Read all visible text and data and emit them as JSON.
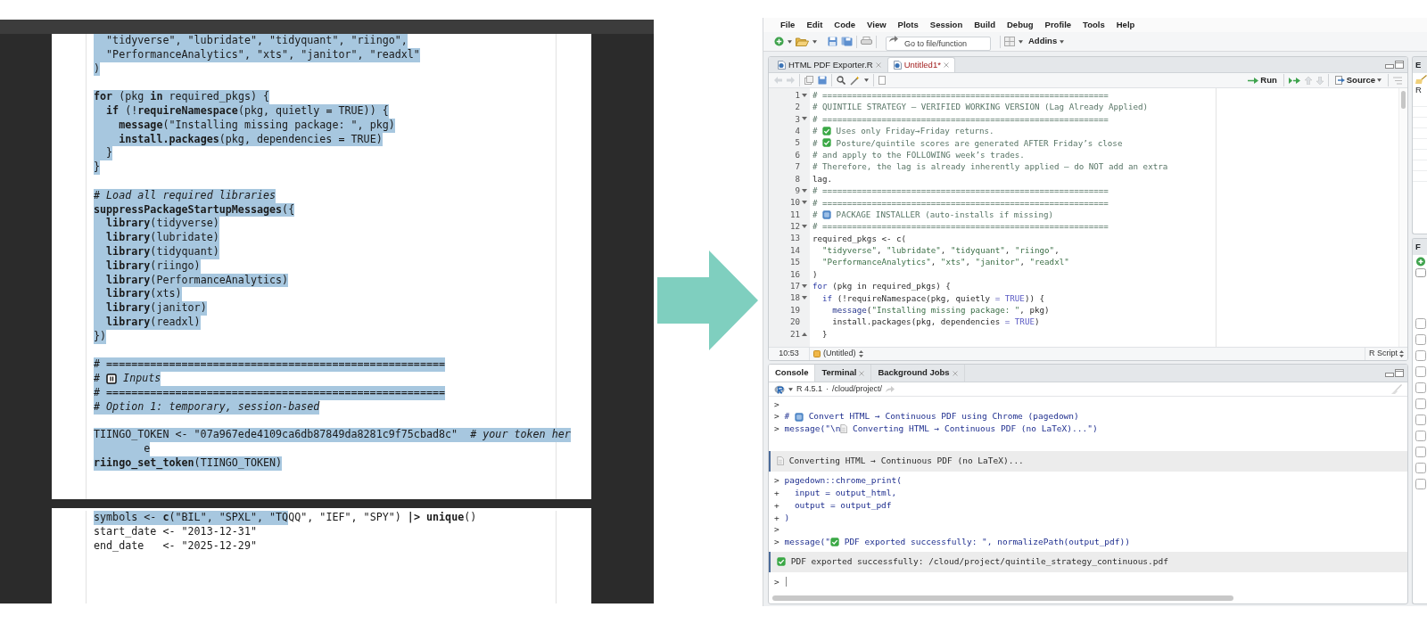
{
  "pdf": {
    "pages": [
      {
        "lines": [
          {
            "gap": false,
            "parts": [
              {
                "kind": "code",
                "text": "  \"tidyverse\", \"lubridate\", \"tidyquant\", \"riingo\",",
                "selected": true
              }
            ]
          },
          {
            "gap": false,
            "parts": [
              {
                "kind": "code",
                "text": "  \"PerformanceAnalytics\", \"xts\", \"janitor\", \"readxl\"",
                "selected": true
              }
            ]
          },
          {
            "gap": false,
            "parts": [
              {
                "kind": "code",
                "text": ")",
                "selected": true
              }
            ]
          },
          {
            "gap": true,
            "parts": [
              {
                "kind": "code",
                "text": "**for** (pkg **in** required_pkgs) {",
                "selected": true
              }
            ]
          },
          {
            "gap": false,
            "parts": [
              {
                "kind": "code",
                "text": "  **if** (!**requireNamespace**(pkg, quietly = TRUE)) {",
                "selected": true
              }
            ]
          },
          {
            "gap": false,
            "parts": [
              {
                "kind": "code",
                "text": "    **message**(\"Installing missing package: \", pkg)",
                "selected": true
              }
            ]
          },
          {
            "gap": false,
            "parts": [
              {
                "kind": "code",
                "text": "    **install.packages**(pkg, dependencies = TRUE)",
                "selected": true
              }
            ]
          },
          {
            "gap": false,
            "parts": [
              {
                "kind": "code",
                "text": "  }",
                "selected": true
              }
            ]
          },
          {
            "gap": false,
            "parts": [
              {
                "kind": "code",
                "text": "}",
                "selected": true
              }
            ]
          },
          {
            "gap": true,
            "parts": [
              {
                "kind": "comment",
                "text": "# Load all required libraries",
                "selected": true
              }
            ]
          },
          {
            "gap": false,
            "parts": [
              {
                "kind": "code",
                "text": "**suppressPackageStartupMessages**({",
                "selected": true
              }
            ]
          },
          {
            "gap": false,
            "parts": [
              {
                "kind": "code",
                "text": "  **library**(tidyverse)",
                "selected": true
              }
            ]
          },
          {
            "gap": false,
            "parts": [
              {
                "kind": "code",
                "text": "  **library**(lubridate)",
                "selected": true
              }
            ]
          },
          {
            "gap": false,
            "parts": [
              {
                "kind": "code",
                "text": "  **library**(tidyquant)",
                "selected": true
              }
            ]
          },
          {
            "gap": false,
            "parts": [
              {
                "kind": "code",
                "text": "  **library**(riingo)",
                "selected": true
              }
            ]
          },
          {
            "gap": false,
            "parts": [
              {
                "kind": "code",
                "text": "  **library**(PerformanceAnalytics)",
                "selected": true
              }
            ]
          },
          {
            "gap": false,
            "parts": [
              {
                "kind": "code",
                "text": "  **library**(xts)",
                "selected": true
              }
            ]
          },
          {
            "gap": false,
            "parts": [
              {
                "kind": "code",
                "text": "  **library**(janitor)",
                "selected": true
              }
            ]
          },
          {
            "gap": false,
            "parts": [
              {
                "kind": "code",
                "text": "  **library**(readxl)",
                "selected": true
              }
            ]
          },
          {
            "gap": false,
            "parts": [
              {
                "kind": "code",
                "text": "})",
                "selected": true
              }
            ]
          },
          {
            "gap": true,
            "parts": [
              {
                "kind": "comment",
                "text": "# ======================================================",
                "selected": true
              }
            ]
          },
          {
            "gap": false,
            "parts": [
              {
                "kind": "comment",
                "text": "# ",
                "selected": true
              },
              {
                "kind": "keycap",
                "selected": true
              },
              {
                "kind": "comment",
                "text": " Inputs",
                "selected": true
              }
            ]
          },
          {
            "gap": false,
            "parts": [
              {
                "kind": "comment",
                "text": "# ======================================================",
                "selected": true
              }
            ]
          },
          {
            "gap": false,
            "parts": [
              {
                "kind": "comment",
                "text": "# Option 1: temporary, session-based",
                "selected": true
              }
            ]
          },
          {
            "gap": true,
            "parts": [
              {
                "kind": "code",
                "text": "TIINGO_TOKEN <- \"07a967ede4109ca6db87849da8281c9f75cbad8c\"  ",
                "selected": true
              },
              {
                "kind": "comment",
                "text": "# your token her",
                "selected": true
              }
            ]
          },
          {
            "gap": false,
            "parts": [
              {
                "kind": "code",
                "text": "        e",
                "selected": true
              }
            ]
          },
          {
            "gap": false,
            "parts": [
              {
                "kind": "code",
                "text": "**riingo_set_token**(TIINGO_TOKEN)",
                "selected": true
              }
            ]
          }
        ]
      },
      {
        "lines": [
          {
            "parts": [
              {
                "kind": "code",
                "text": "symbols <- **c**(\"BIL\", \"SPXL\", \"TQ",
                "selected": true
              },
              {
                "kind": "code",
                "text": "QQ\", \"IEF\", \"SPY\") **|>** **unique**()",
                "selected": false
              }
            ]
          },
          {
            "parts": [
              {
                "kind": "code",
                "text": "start_date <- \"2013-12-31\"",
                "selected": false
              }
            ]
          },
          {
            "parts": [
              {
                "kind": "code",
                "text": "end_date   <- \"2025-12-29\"",
                "selected": false
              }
            ]
          }
        ]
      }
    ]
  },
  "rstudio": {
    "menu": [
      "File",
      "Edit",
      "Code",
      "View",
      "Plots",
      "Session",
      "Build",
      "Debug",
      "Profile",
      "Tools",
      "Help"
    ],
    "toolbar": {
      "goto_placeholder": "Go to file/function",
      "addins": "Addins"
    },
    "editor": {
      "tabs": [
        {
          "label": "HTML PDF Exporter.R",
          "selected": false,
          "modified": false
        },
        {
          "label": "Untitled1*",
          "selected": true,
          "modified": true
        }
      ],
      "run": "Run",
      "source": "Source",
      "lines": [
        {
          "num": "1",
          "kind": "fold_start",
          "segs": [
            {
              "kind": "comment",
              "text": "# =========================================================="
            }
          ]
        },
        {
          "num": "2",
          "kind": "plain",
          "segs": [
            {
              "kind": "comment",
              "text": "# QUINTILE STRATEGY – VERIFIED WORKING VERSION (Lag Already Applied)"
            }
          ]
        },
        {
          "num": "3",
          "kind": "fold_start",
          "segs": [
            {
              "kind": "comment",
              "text": "# =========================================================="
            }
          ]
        },
        {
          "num": "4",
          "kind": "plain",
          "segs": [
            {
              "kind": "comment",
              "text": "# "
            },
            {
              "kind": "check"
            },
            {
              "kind": "comment",
              "text": " Uses only Friday→Friday returns."
            }
          ]
        },
        {
          "num": "5",
          "kind": "plain",
          "segs": [
            {
              "kind": "comment",
              "text": "# "
            },
            {
              "kind": "check"
            },
            {
              "kind": "comment",
              "text": " Posture/quintile scores are generated AFTER Friday’s close"
            }
          ]
        },
        {
          "num": "6",
          "kind": "plain",
          "segs": [
            {
              "kind": "comment",
              "text": "# and apply to the FOLLOWING week’s trades."
            }
          ]
        },
        {
          "num": "7",
          "kind": "plain",
          "segs": [
            {
              "kind": "comment",
              "text": "# Therefore, the lag is already inherently applied – do NOT add an extra"
            }
          ]
        },
        {
          "num": "8",
          "kind": "plain",
          "segs": [
            {
              "kind": "plain",
              "text": "lag."
            }
          ]
        },
        {
          "num": "9",
          "kind": "fold_start",
          "segs": [
            {
              "kind": "comment",
              "text": "# =========================================================="
            }
          ]
        },
        {
          "num": "10",
          "kind": "fold_start",
          "segs": [
            {
              "kind": "comment",
              "text": "# =========================================================="
            }
          ]
        },
        {
          "num": "11",
          "kind": "plain",
          "segs": [
            {
              "kind": "comment",
              "text": "# "
            },
            {
              "kind": "keycap"
            },
            {
              "kind": "comment",
              "text": " PACKAGE INSTALLER (auto-installs if missing)"
            }
          ]
        },
        {
          "num": "12",
          "kind": "fold_start",
          "segs": [
            {
              "kind": "comment",
              "text": "# =========================================================="
            }
          ]
        },
        {
          "num": "13",
          "kind": "plain",
          "segs": [
            {
              "kind": "plain",
              "text": "required_pkgs <- c("
            }
          ]
        },
        {
          "num": "14",
          "kind": "plain",
          "segs": [
            {
              "kind": "string",
              "text": "  \"tidyverse\""
            },
            {
              "kind": "plain",
              "text": ", "
            },
            {
              "kind": "string",
              "text": "\"lubridate\""
            },
            {
              "kind": "plain",
              "text": ", "
            },
            {
              "kind": "string",
              "text": "\"tidyquant\""
            },
            {
              "kind": "plain",
              "text": ", "
            },
            {
              "kind": "string",
              "text": "\"riingo\""
            },
            {
              "kind": "plain",
              "text": ","
            }
          ]
        },
        {
          "num": "15",
          "kind": "plain",
          "segs": [
            {
              "kind": "string",
              "text": "  \"PerformanceAnalytics\""
            },
            {
              "kind": "plain",
              "text": ", "
            },
            {
              "kind": "string",
              "text": "\"xts\""
            },
            {
              "kind": "plain",
              "text": ", "
            },
            {
              "kind": "string",
              "text": "\"janitor\""
            },
            {
              "kind": "plain",
              "text": ", "
            },
            {
              "kind": "string",
              "text": "\"readxl\""
            }
          ]
        },
        {
          "num": "16",
          "kind": "plain",
          "segs": [
            {
              "kind": "plain",
              "text": ")"
            }
          ]
        },
        {
          "num": "17",
          "kind": "fold_start",
          "segs": [
            {
              "kind": "keyword",
              "text": "for"
            },
            {
              "kind": "plain",
              "text": " (pkg in required_pkgs) {"
            }
          ]
        },
        {
          "num": "18",
          "kind": "fold_start",
          "segs": [
            {
              "kind": "keyword",
              "text": "  if"
            },
            {
              "kind": "plain",
              "text": " (!requireNamespace(pkg, quietly "
            },
            {
              "kind": "operator",
              "text": "="
            },
            {
              "kind": "constant",
              "text": " TRUE"
            },
            {
              "kind": "plain",
              "text": ")) {"
            }
          ]
        },
        {
          "num": "19",
          "kind": "plain",
          "segs": [
            {
              "kind": "function",
              "text": "    message"
            },
            {
              "kind": "plain",
              "text": "("
            },
            {
              "kind": "string",
              "text": "\"Installing missing package: \""
            },
            {
              "kind": "plain",
              "text": ", pkg)"
            }
          ]
        },
        {
          "num": "20",
          "kind": "plain",
          "segs": [
            {
              "kind": "plain",
              "text": "    install.packages(pkg, dependencies "
            },
            {
              "kind": "operator",
              "text": "="
            },
            {
              "kind": "constant",
              "text": " TRUE"
            },
            {
              "kind": "plain",
              "text": ")"
            }
          ]
        },
        {
          "num": "21",
          "kind": "fold_end",
          "segs": [
            {
              "kind": "plain",
              "text": "  }"
            }
          ]
        }
      ],
      "status": {
        "position": "10:53",
        "scope": "(Untitled)",
        "filetype": "R Script"
      }
    },
    "console": {
      "tabs": [
        {
          "label": "Console",
          "selected": true,
          "closable": false
        },
        {
          "label": "Terminal",
          "selected": false,
          "closable": true
        },
        {
          "label": "Background Jobs",
          "selected": false,
          "closable": true
        }
      ],
      "version": "R 4.5.1",
      "separator": "·",
      "path": "/cloud/project/",
      "lines": [
        {
          "kind": "input",
          "segs": [
            {
              "kind": "prompt",
              "text": ">"
            }
          ]
        },
        {
          "kind": "input",
          "segs": [
            {
              "kind": "prompt",
              "text": "> "
            },
            {
              "kind": "code",
              "text": "# "
            },
            {
              "kind": "keycap"
            },
            {
              "kind": "code",
              "text": " Convert HTML → Continuous PDF using Chrome (pagedown)"
            }
          ]
        },
        {
          "kind": "input",
          "segs": [
            {
              "kind": "prompt",
              "text": "> "
            },
            {
              "kind": "code",
              "text": "message(\"\\n"
            },
            {
              "kind": "doc"
            },
            {
              "kind": "code",
              "text": " Converting HTML → Continuous PDF (no LaTeX)...\")"
            }
          ]
        },
        {
          "kind": "blank"
        },
        {
          "kind": "output",
          "segs": [
            {
              "kind": "doc"
            },
            {
              "kind": "output",
              "text": " Converting HTML → Continuous PDF (no LaTeX)..."
            }
          ]
        },
        {
          "kind": "input",
          "segs": [
            {
              "kind": "prompt",
              "text": "> "
            },
            {
              "kind": "code",
              "text": "pagedown::chrome_print("
            }
          ]
        },
        {
          "kind": "input",
          "segs": [
            {
              "kind": "prompt",
              "text": "+ "
            },
            {
              "kind": "code",
              "text": "  input = output_html,"
            }
          ]
        },
        {
          "kind": "input",
          "segs": [
            {
              "kind": "prompt",
              "text": "+ "
            },
            {
              "kind": "code",
              "text": "  output = output_pdf"
            }
          ]
        },
        {
          "kind": "input",
          "segs": [
            {
              "kind": "prompt",
              "text": "+ "
            },
            {
              "kind": "code",
              "text": ")"
            }
          ]
        },
        {
          "kind": "input",
          "segs": [
            {
              "kind": "prompt",
              "text": ">"
            }
          ]
        },
        {
          "kind": "input",
          "segs": [
            {
              "kind": "prompt",
              "text": "> "
            },
            {
              "kind": "code",
              "text": "message(\""
            },
            {
              "kind": "check"
            },
            {
              "kind": "code",
              "text": " PDF exported successfully: \", normalizePath(output_pdf))"
            }
          ]
        },
        {
          "kind": "output",
          "segs": [
            {
              "kind": "check"
            },
            {
              "kind": "output",
              "text": " PDF exported successfully: /cloud/project/quintile_strategy_continuous.pdf"
            }
          ]
        },
        {
          "kind": "prompt",
          "segs": [
            {
              "kind": "prompt",
              "text": "> "
            }
          ]
        }
      ]
    },
    "side": {
      "top_header": "E",
      "top_row": "R",
      "bottom_header": "F"
    }
  }
}
